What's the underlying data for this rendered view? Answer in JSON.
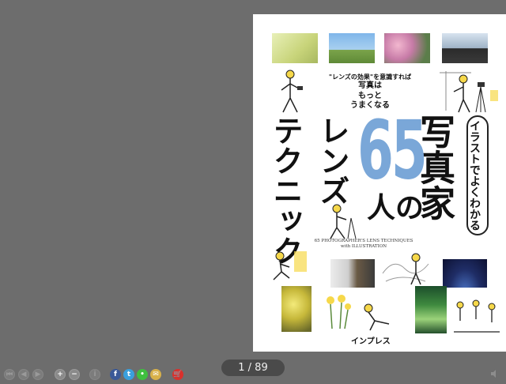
{
  "book": {
    "tagline_line1": "\"レンズの効果\"を意識すれば",
    "tagline_line2": "写真は",
    "tagline_line3": "もっと",
    "tagline_line4": "うまくなる",
    "bubble_text": "イラストでよくわかる",
    "title_main": "写真家",
    "title_number": "65",
    "title_nin_no": "人の",
    "title_lens": "レンズ",
    "title_technique": "テクニック",
    "subtitle_line1": "65 PHOTOGRAPHER'S LENS TECHNIQUES",
    "subtitle_line2": "with ILLUSTRATION",
    "publisher": "インプレス"
  },
  "navigation": {
    "page_indicator": "1 / 89"
  },
  "colors": {
    "background": "#6d6d6d",
    "accent_number": "#7aa7d8",
    "cart": "#d9302c",
    "facebook": "#3b5998",
    "twitter": "#3aa0dd",
    "line": "#3fbf3f",
    "mail": "#d8b14a"
  },
  "icons": [
    "first-page-icon",
    "prev-page-icon",
    "next-page-icon",
    "zoom-in-icon",
    "zoom-out-icon",
    "info-icon",
    "facebook-icon",
    "twitter-icon",
    "line-icon",
    "mail-icon",
    "cart-icon",
    "sound-icon"
  ]
}
